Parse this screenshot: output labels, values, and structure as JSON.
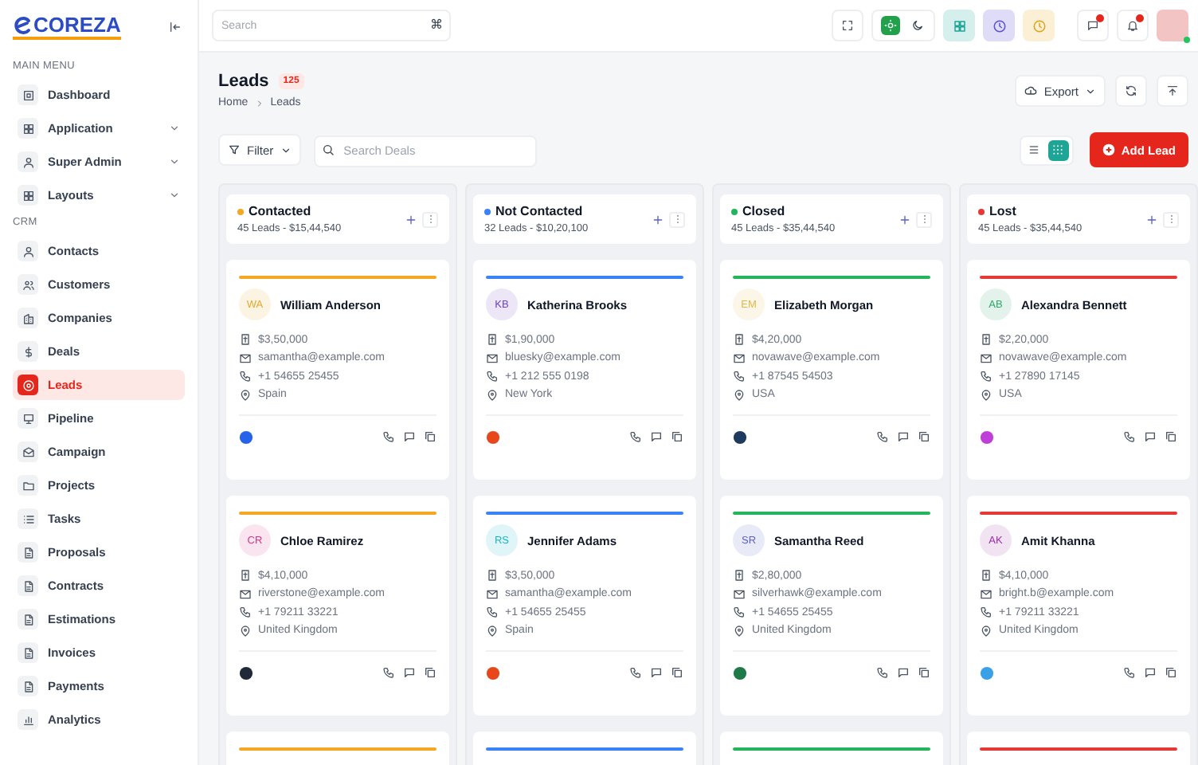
{
  "sidebar": {
    "logo": "COREZA",
    "sections": [
      {
        "title": "MAIN MENU",
        "items": [
          {
            "label": "Dashboard",
            "expandable": false,
            "selected": false
          },
          {
            "label": "Application",
            "expandable": true,
            "selected": false
          },
          {
            "label": "Super Admin",
            "expandable": true,
            "selected": false
          },
          {
            "label": "Layouts",
            "expandable": true,
            "selected": false
          }
        ]
      },
      {
        "title": "CRM",
        "items": [
          {
            "label": "Contacts",
            "expandable": false,
            "selected": false
          },
          {
            "label": "Customers",
            "expandable": false,
            "selected": false
          },
          {
            "label": "Companies",
            "expandable": false,
            "selected": false
          },
          {
            "label": "Deals",
            "expandable": false,
            "selected": false
          },
          {
            "label": "Leads",
            "expandable": false,
            "selected": true
          },
          {
            "label": "Pipeline",
            "expandable": false,
            "selected": false
          },
          {
            "label": "Campaign",
            "expandable": false,
            "selected": false
          },
          {
            "label": "Projects",
            "expandable": false,
            "selected": false
          },
          {
            "label": "Tasks",
            "expandable": false,
            "selected": false
          },
          {
            "label": "Proposals",
            "expandable": false,
            "selected": false
          },
          {
            "label": "Contracts",
            "expandable": false,
            "selected": false
          },
          {
            "label": "Estimations",
            "expandable": false,
            "selected": false
          },
          {
            "label": "Invoices",
            "expandable": false,
            "selected": false
          },
          {
            "label": "Payments",
            "expandable": false,
            "selected": false
          },
          {
            "label": "Analytics",
            "expandable": false,
            "selected": false
          }
        ]
      }
    ]
  },
  "header": {
    "search": {
      "placeholder": "Search",
      "shortcut": "⌘"
    },
    "theme": {
      "dark": false
    }
  },
  "page": {
    "title": "Leads",
    "count": "125",
    "breadcrumb": [
      "Home",
      "Leads"
    ],
    "export": "Export"
  },
  "toolbar": {
    "filter": "Filter",
    "search": {
      "placeholder": "Search Deals"
    },
    "views": [
      {
        "kind": "list",
        "selected": false
      },
      {
        "kind": "grid",
        "selected": true
      }
    ],
    "add_button": "Add Lead"
  },
  "columns": [
    {
      "title": "Contacted",
      "color": "#f5a623",
      "summary": "45 Leads - $15,44,540",
      "cards": [
        {
          "initials": "WA",
          "name": "William Anderson",
          "color": "#e8a92c",
          "amount": "$3,50,000",
          "email": "samantha@example.com",
          "phone": "+1 54655 25455",
          "location": "Spain"
        },
        {
          "initials": "CR",
          "name": "Chloe Ramirez",
          "color": "#d63384",
          "amount": "$4,10,000",
          "email": "riverstone@example.com",
          "phone": "+1 79211 33221",
          "location": "United Kingdom"
        }
      ]
    },
    {
      "title": "Not Contacted",
      "color": "#3b82f6",
      "summary": "32 Leads - $10,20,100",
      "cards": [
        {
          "initials": "KB",
          "name": "Katherina Brooks",
          "color": "#6f42c1",
          "amount": "$1,90,000",
          "email": "bluesky@example.com",
          "phone": "+1 212 555 0198",
          "location": "New York"
        },
        {
          "initials": "RS",
          "name": "Jennifer Adams",
          "color": "#1ab5c8",
          "amount": "$3,50,000",
          "email": "samantha@example.com",
          "phone": "+1 54655 25455",
          "location": "Spain"
        }
      ]
    },
    {
      "title": "Closed",
      "color": "#22b55a",
      "summary": "45 Leads - $35,44,540",
      "cards": [
        {
          "initials": "EM",
          "name": "Elizabeth Morgan",
          "color": "#e0b84a",
          "amount": "$4,20,000",
          "email": "novawave@example.com",
          "phone": "+1 87545 54503",
          "location": "USA"
        },
        {
          "initials": "SR",
          "name": "Samantha Reed",
          "color": "#5b5fc7",
          "amount": "$2,80,000",
          "email": "silverhawk@example.com",
          "phone": "+1 54655 25455",
          "location": "United Kingdom"
        }
      ]
    },
    {
      "title": "Lost",
      "color": "#e53935",
      "summary": "45 Leads - $35,44,540",
      "cards": [
        {
          "initials": "AB",
          "name": "Alexandra Bennett",
          "color": "#2fa86a",
          "amount": "$2,20,000",
          "email": "novawave@example.com",
          "phone": "+1 27890 17145",
          "location": "USA"
        },
        {
          "initials": "AK",
          "name": "Amit Khanna",
          "color": "#9c2fa8",
          "amount": "$4,10,000",
          "email": "bright.b@example.com",
          "phone": "+1 79211 33221",
          "location": "United Kingdom"
        }
      ]
    }
  ]
}
